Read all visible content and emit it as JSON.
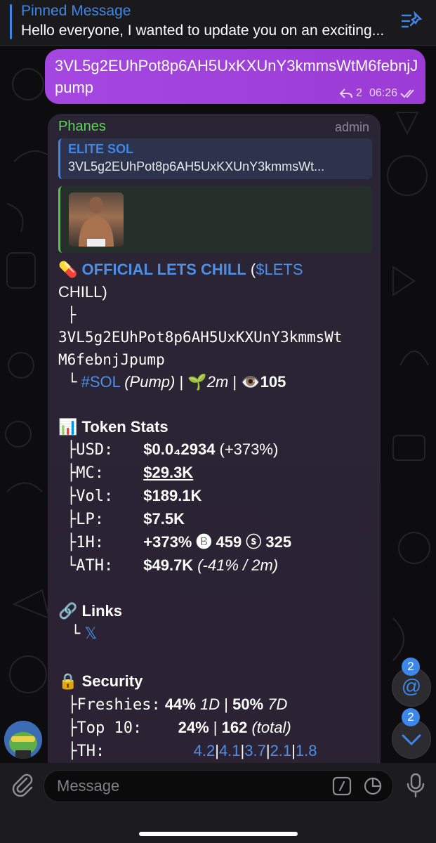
{
  "pinned": {
    "title": "Pinned Message",
    "text": "Hello everyone, I wanted to update you on an exciting..."
  },
  "outgoing": {
    "text": "3VL5g2EUhPot8p6AH5UxKXUnY3kmmsWtM6febnjJpump",
    "replies": "2",
    "time": "06:26"
  },
  "incoming": {
    "sender": "Phanes",
    "role": "admin",
    "reply": {
      "title": "ELITE SOL",
      "text": "3VL5g2EUhPot8p6AH5UxKXUnY3kmmsWt..."
    },
    "token": {
      "emoji": "💊",
      "name": "OFFICIAL LETS CHILL",
      "ticker_open": "(",
      "ticker": "$LETS",
      "ticker_tail": "CHILL)",
      "address_line1": "3VL5g2EUhPot8p6AH5UxKXUnY3kmmsWt",
      "address_line2": "M6febnjJpump",
      "chain": "#SOL",
      "platform": "(Pump)",
      "sep1": "|",
      "age_emoji": "🌱",
      "age": "2m",
      "sep2": "|",
      "views_emoji": "👁️",
      "views": "105"
    },
    "stats": {
      "heading_emoji": "📊",
      "heading": "Token Stats",
      "rows": [
        {
          "tree": "├",
          "label": "USD:",
          "value": "$0.0₄2934",
          "extra": "(+373%)"
        },
        {
          "tree": "├",
          "label": "MC:",
          "value": "$29.3K",
          "extra": ""
        },
        {
          "tree": "├",
          "label": "Vol:",
          "value": "$189.1K",
          "extra": ""
        },
        {
          "tree": "├",
          "label": "LP:",
          "value": "$7.5K",
          "extra": ""
        },
        {
          "tree": "├",
          "label": "1H:",
          "value": "+373%",
          "extra": "🅑 459 ⓢ 325"
        },
        {
          "tree": "└",
          "label": "ATH:",
          "value": "$49.7K",
          "extra": "(-41% / 2m)"
        }
      ]
    },
    "links": {
      "heading_emoji": "🔗",
      "heading": "Links",
      "tree": "└",
      "x_label": "𝕏"
    },
    "security": {
      "heading_emoji": "🔒",
      "heading": "Security",
      "freshies_label": "Freshies:",
      "freshies_1d": "44%",
      "freshies_1d_unit": "1D",
      "freshies_sep": "|",
      "freshies_7d": "50%",
      "freshies_7d_unit": "7D",
      "top10_label": "Top 10:",
      "top10_pct": "24%",
      "top10_sep": "|",
      "top10_total": "162",
      "top10_total_unit": "(total)",
      "th_label": "TH:",
      "th_values": [
        "4.2",
        "4.1",
        "3.7",
        "2.1",
        "1.8"
      ]
    }
  },
  "floating": {
    "mentions_badge": "2",
    "mentions_icon": "@",
    "down_badge": "2"
  },
  "input": {
    "placeholder": "Message"
  },
  "colors": {
    "accent": "#3e87e8",
    "outgoing": "#a447e0",
    "sender": "#5fd25a"
  }
}
